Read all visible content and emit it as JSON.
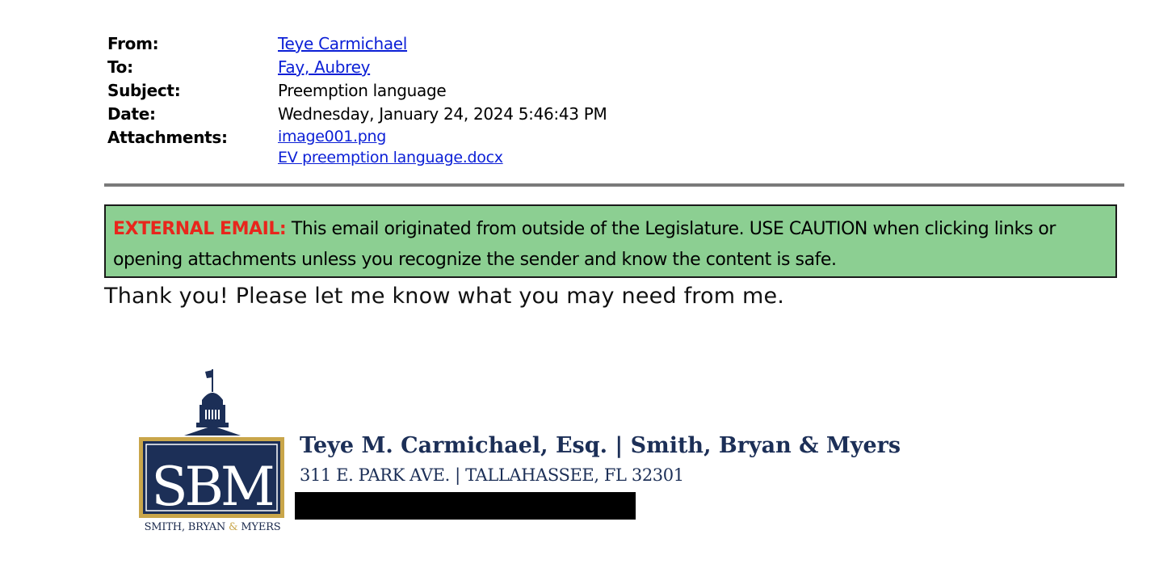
{
  "header": {
    "from_label": "From:",
    "from_value": "Teye Carmichael",
    "to_label": "To:",
    "to_value": "Fay, Aubrey",
    "subject_label": "Subject:",
    "subject_value": "Preemption language",
    "date_label": "Date:",
    "date_value": "Wednesday, January 24, 2024 5:46:43 PM",
    "attachments_label": "Attachments:",
    "attachments": [
      "image001.png",
      "EV preemption language.docx"
    ]
  },
  "banner": {
    "tag": "EXTERNAL EMAIL:",
    "message": " This email originated from outside of the Legislature. USE CAUTION when clicking links or opening attachments unless you recognize the sender and know the content is safe.",
    "color_tag": "#e8261c",
    "color_background": "#8ccf92"
  },
  "body": {
    "text": "Thank you!  Please let me know what you may need from me."
  },
  "signature": {
    "logo_letters": "SBM",
    "logo_caption_part1": "SMITH, BRYAN ",
    "logo_caption_amp": "&",
    "logo_caption_part2": " MYERS",
    "name_line": "Teye M. Carmichael, Esq. | Smith, Bryan & Myers",
    "address_line": "311 E. PARK AVE. | TALLAHASSEE, FL 32301",
    "color_navy": "#1c2f57",
    "color_gold": "#c9a64a"
  }
}
